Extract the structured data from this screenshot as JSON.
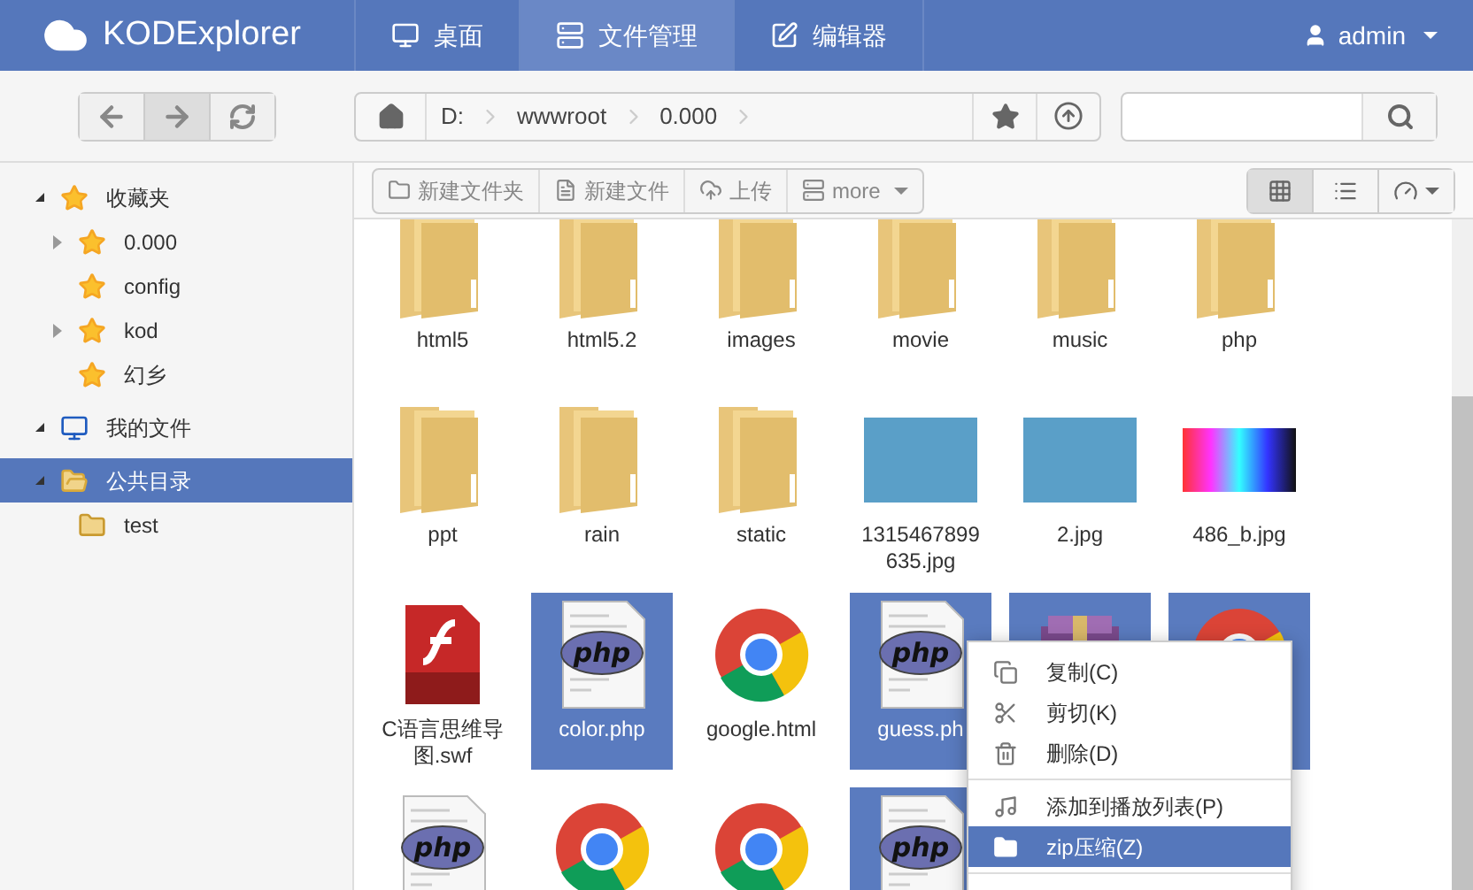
{
  "app": {
    "title": "KODExplorer"
  },
  "nav_tabs": [
    {
      "label": "桌面",
      "selected": false
    },
    {
      "label": "文件管理",
      "selected": true
    },
    {
      "label": "编辑器",
      "selected": false
    }
  ],
  "user_menu": {
    "label": "admin"
  },
  "breadcrumb": [
    "D:",
    "wwwroot",
    "0.000"
  ],
  "toolbar": [
    {
      "label": "新建文件夹"
    },
    {
      "label": "新建文件"
    },
    {
      "label": "上传"
    },
    {
      "label": "more"
    }
  ],
  "view_modes": [
    {
      "kind": "grid",
      "selected": true
    },
    {
      "kind": "list",
      "selected": false
    }
  ],
  "sidebar": {
    "tree": [
      {
        "label": "收藏夹",
        "kind": "favorite",
        "expandable": true,
        "expanded": true,
        "selected": false,
        "children": [
          {
            "label": "0.000",
            "kind": "favorite",
            "expandable": true,
            "expanded": false,
            "selected": false
          },
          {
            "label": "config",
            "kind": "favorite",
            "expandable": false,
            "expanded": false,
            "selected": false
          },
          {
            "label": "kod",
            "kind": "favorite",
            "expandable": true,
            "expanded": false,
            "selected": false
          },
          {
            "label": "幻乡",
            "kind": "favorite",
            "expandable": false,
            "expanded": false,
            "selected": false
          }
        ]
      },
      {
        "label": "我的文件",
        "kind": "computer",
        "expandable": true,
        "expanded": true,
        "selected": false
      },
      {
        "label": "公共目录",
        "kind": "shared",
        "expandable": true,
        "expanded": true,
        "selected": true,
        "children": [
          {
            "label": "test",
            "kind": "folder",
            "expandable": false,
            "expanded": false,
            "selected": false
          }
        ]
      }
    ]
  },
  "files": [
    {
      "kind": "folder",
      "name": "html5",
      "selected": false
    },
    {
      "kind": "folder",
      "name": "html5.2",
      "selected": false
    },
    {
      "kind": "folder",
      "name": "images",
      "selected": false
    },
    {
      "kind": "folder",
      "name": "movie",
      "selected": false
    },
    {
      "kind": "folder",
      "name": "music",
      "selected": false
    },
    {
      "kind": "folder",
      "name": "php",
      "selected": false
    },
    {
      "kind": "folder",
      "name": "ppt",
      "selected": false
    },
    {
      "kind": "folder",
      "name": "rain",
      "selected": false
    },
    {
      "kind": "folder",
      "name": "static",
      "selected": false
    },
    {
      "kind": "photo",
      "name": "1315467899635.jpg",
      "selected": false
    },
    {
      "kind": "photo",
      "name": "2.jpg",
      "selected": false
    },
    {
      "kind": "gradient",
      "name": "486_b.jpg",
      "selected": false
    },
    {
      "kind": "swf",
      "name": "C语言思维导图.swf",
      "selected": false
    },
    {
      "kind": "php",
      "name": "color.php",
      "selected": true
    },
    {
      "kind": "browser",
      "name": "google.html",
      "selected": false
    },
    {
      "kind": "php",
      "name": "guess.ph",
      "selected": true
    },
    {
      "kind": "archive",
      "selected": true
    },
    {
      "kind": "browser",
      "selected": true
    },
    {
      "kind": "php",
      "selected": false
    },
    {
      "kind": "browser",
      "selected": false
    },
    {
      "kind": "browser",
      "selected": false
    },
    {
      "kind": "php",
      "selected": true
    }
  ],
  "context_menu": [
    {
      "kind": "item",
      "label": "复制(C)",
      "selected": false
    },
    {
      "kind": "item",
      "label": "剪切(K)",
      "selected": false
    },
    {
      "kind": "item",
      "label": "删除(D)",
      "selected": false
    },
    {
      "kind": "divider"
    },
    {
      "kind": "item",
      "label": "添加到播放列表(P)",
      "selected": false
    },
    {
      "kind": "item",
      "label": "zip压缩(Z)",
      "selected": true
    },
    {
      "kind": "divider"
    }
  ]
}
